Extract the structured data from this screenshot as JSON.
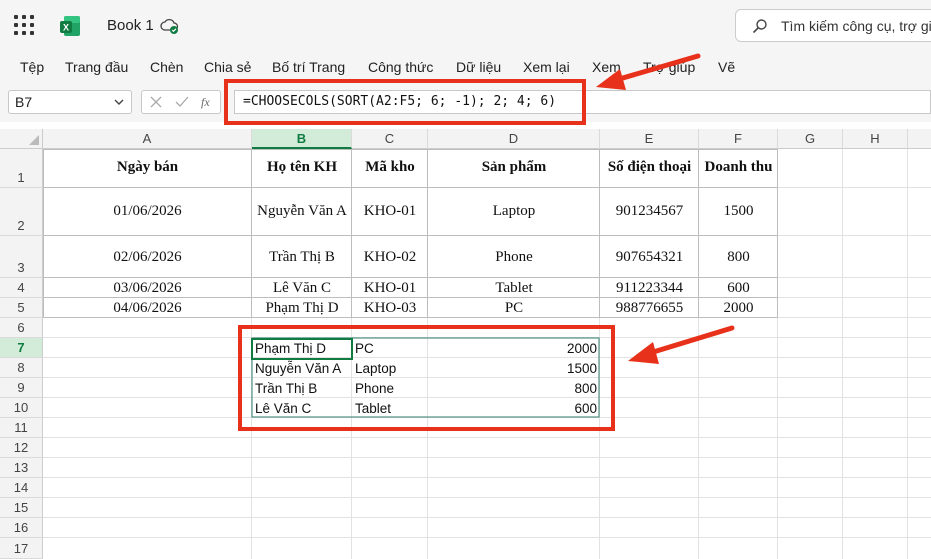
{
  "app": {
    "book_title": "Book 1"
  },
  "search": {
    "placeholder": "Tìm kiếm công cụ, trợ giú"
  },
  "menu": [
    "Tệp",
    "Trang đầu",
    "Chèn",
    "Chia sẻ",
    "Bố trí Trang",
    "Công thức",
    "Dữ liệu",
    "Xem lại",
    "Xem",
    "Trợ giúp",
    "Vẽ"
  ],
  "namebox": {
    "value": "B7"
  },
  "formula": {
    "text": "=CHOOSECOLS(SORT(A2:F5; 6; -1); 2; 4; 6)"
  },
  "columns": [
    "A",
    "B",
    "C",
    "D",
    "E",
    "F",
    "G",
    "H"
  ],
  "rows": [
    "1",
    "2",
    "3",
    "4",
    "5",
    "6",
    "7",
    "8",
    "9",
    "10",
    "11",
    "12",
    "13",
    "14",
    "15",
    "16",
    "17"
  ],
  "headers": [
    "Ngày bán",
    "Họ tên KH",
    "Mã kho",
    "Sản phẩm",
    "Số điện thoại",
    "Doanh thu"
  ],
  "table": [
    [
      "01/06/2026",
      "Nguyễn Văn A",
      "KHO-01",
      "Laptop",
      "901234567",
      "1500"
    ],
    [
      "02/06/2026",
      "Trần Thị B",
      "KHO-02",
      "Phone",
      "907654321",
      "800"
    ],
    [
      "03/06/2026",
      "Lê Văn C",
      "KHO-01",
      "Tablet",
      "911223344",
      "600"
    ],
    [
      "04/06/2026",
      "Phạm Thị D",
      "KHO-03",
      "PC",
      "988776655",
      "2000"
    ]
  ],
  "result": [
    [
      "Phạm Thị D",
      "PC",
      "2000"
    ],
    [
      "Nguyễn Văn A",
      "Laptop",
      "1500"
    ],
    [
      "Trần Thị B",
      "Phone",
      "800"
    ],
    [
      "Lê Văn C",
      "Tablet",
      "600"
    ]
  ],
  "colors": {
    "accent_green": "#107c41",
    "annotation_red": "#e8311a"
  }
}
